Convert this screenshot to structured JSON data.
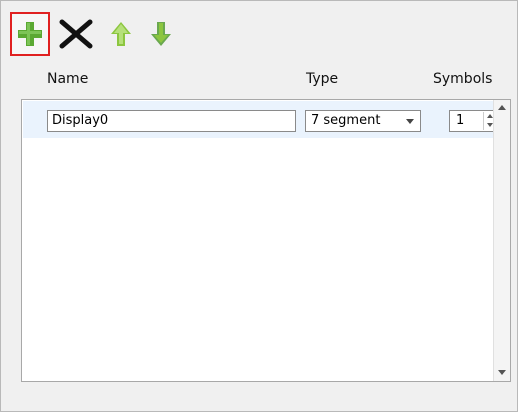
{
  "toolbar": {
    "add_icon": "plus-icon",
    "remove_icon": "x-icon",
    "move_up_icon": "arrow-up-icon",
    "move_down_icon": "arrow-down-icon",
    "colors": {
      "add": "#55a630",
      "remove": "#111111",
      "up": "#8cc63f",
      "down": "#6aa84f",
      "highlight": "#e02020"
    }
  },
  "table": {
    "headers": {
      "name": "Name",
      "type": "Type",
      "symbols": "Symbols"
    },
    "rows": [
      {
        "name": "Display0",
        "type": "7 segment",
        "symbols": "1"
      }
    ]
  }
}
